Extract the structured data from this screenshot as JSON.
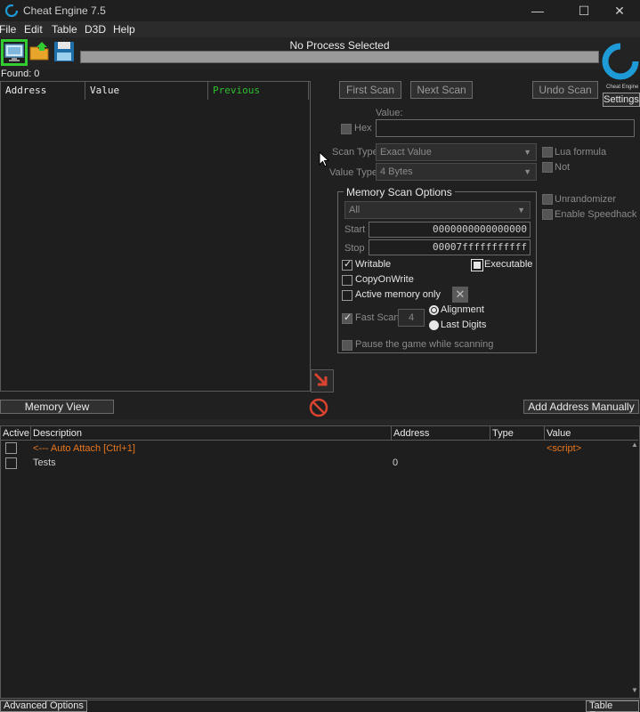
{
  "window": {
    "title": "Cheat Engine 7.5",
    "minimize": "—",
    "maximize": "☐",
    "close": "✕"
  },
  "menu": {
    "items": [
      "File",
      "Edit",
      "Table",
      "D3D",
      "Help"
    ]
  },
  "toolbar": {
    "process_label": "No Process Selected",
    "settings_label": "Settings",
    "logo_text": "Cheat Engine"
  },
  "results": {
    "found_label": "Found: 0",
    "columns": [
      "Address",
      "Value",
      "Previous"
    ]
  },
  "scan": {
    "first_scan": "First Scan",
    "next_scan": "Next Scan",
    "undo_scan": "Undo Scan",
    "value_label": "Value:",
    "hex_label": "Hex",
    "scan_type_label": "Scan Type",
    "scan_type_value": "Exact Value",
    "value_type_label": "Value Type",
    "value_type_value": "4 Bytes",
    "lua_formula": "Lua formula",
    "not_label": "Not",
    "unrandomizer": "Unrandomizer",
    "enable_speedhack": "Enable Speedhack"
  },
  "memory_options": {
    "title": "Memory Scan Options",
    "region_value": "All",
    "start_label": "Start",
    "start_value": "0000000000000000",
    "stop_label": "Stop",
    "stop_value": "00007fffffffffff",
    "writable": "Writable",
    "executable": "Executable",
    "copy_on_write": "CopyOnWrite",
    "active_memory_only": "Active memory only",
    "fast_scan": "Fast Scan",
    "fast_scan_value": "4",
    "alignment": "Alignment",
    "last_digits": "Last Digits",
    "pause_game": "Pause the game while scanning"
  },
  "actions": {
    "memory_view": "Memory View",
    "add_address_manually": "Add Address Manually"
  },
  "address_table": {
    "columns": [
      "Active",
      "Description",
      "Address",
      "Type",
      "Value"
    ],
    "rows": [
      {
        "description": "<--- Auto Attach  [Ctrl+1]",
        "address": "",
        "type": "",
        "value": "<script>"
      },
      {
        "description": "Tests",
        "address": "0",
        "type": "",
        "value": ""
      }
    ]
  },
  "footer": {
    "advanced_options": "Advanced Options",
    "table_extras": "Table Extras"
  },
  "colors": {
    "accent_green": "#33cc33",
    "script_orange": "#e8761e",
    "previous_green": "#2fbf2f",
    "logo_blue": "#1e9bd7"
  }
}
